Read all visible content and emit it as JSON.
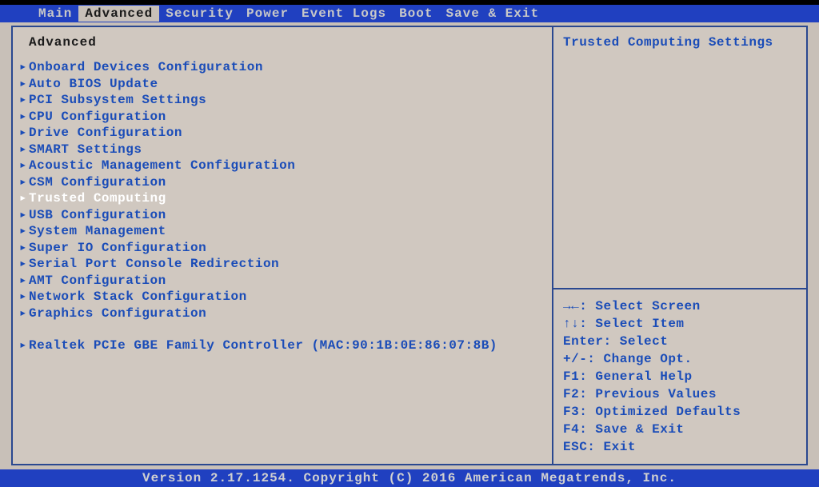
{
  "tabs": {
    "items": [
      "Main",
      "Advanced",
      "Security",
      "Power",
      "Event Logs",
      "Boot",
      "Save & Exit"
    ],
    "active_index": 1
  },
  "left_panel": {
    "title": "Advanced",
    "items": [
      "Onboard Devices Configuration",
      "Auto BIOS Update",
      "PCI Subsystem Settings",
      "CPU Configuration",
      "Drive Configuration",
      "SMART Settings",
      "Acoustic Management Configuration",
      "CSM Configuration",
      "Trusted Computing",
      "USB Configuration",
      "System Management",
      "Super IO Configuration",
      "Serial Port Console Redirection",
      "AMT Configuration",
      "Network Stack Configuration",
      "Graphics Configuration"
    ],
    "selected_index": 8,
    "extra_item": "Realtek PCIe GBE Family Controller (MAC:90:1B:0E:86:07:8B)"
  },
  "right_panel": {
    "title": "Trusted Computing Settings",
    "help": [
      "→←: Select Screen",
      "↑↓: Select Item",
      "Enter: Select",
      "+/-: Change Opt.",
      "F1: General Help",
      "F2: Previous Values",
      "F3: Optimized Defaults",
      "F4: Save & Exit",
      "ESC: Exit"
    ]
  },
  "footer": {
    "text": "Version 2.17.1254. Copyright (C) 2016 American Megatrends, Inc."
  }
}
